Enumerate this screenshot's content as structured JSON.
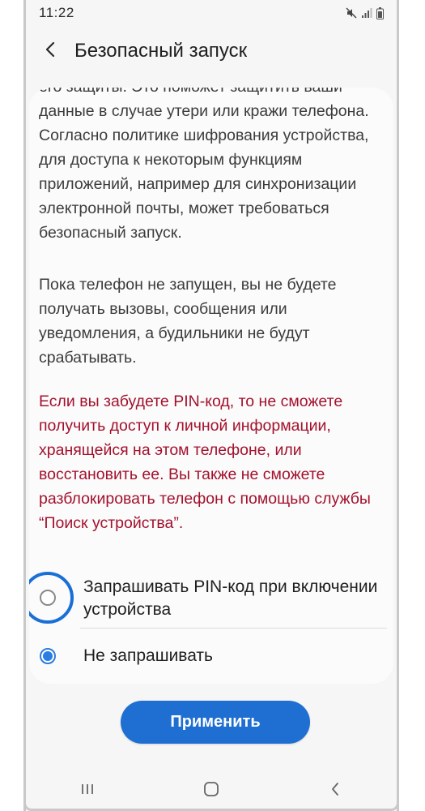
{
  "status_bar": {
    "time": "11:22",
    "icons": [
      "mute-icon",
      "signal-icon",
      "battery-icon"
    ]
  },
  "header": {
    "back_icon": "chevron-left-icon",
    "title": "Безопасный запуск"
  },
  "content": {
    "paragraph1": "его защиты. Это поможет защитить ваши данные в случае утери или кражи телефона. Согласно политике шифрования устройства, для доступа к некоторым функциям приложений, например для синхронизации электронной почты, может требоваться безопасный запуск.",
    "paragraph2": "Пока телефон не запущен, вы не будете получать вызовы, сообщения или уведомления, а будильники не будут срабатывать.",
    "warning": "Если вы забудете PIN-код, то не сможете получить доступ к личной информации, хранящейся на этом телефоне, или восстановить ее. Вы также не сможете разблокировать телефон с помощью службы “Поиск устройства”."
  },
  "options": [
    {
      "label": "Запрашивать PIN-код при включении устройства",
      "selected": false,
      "highlighted": true
    },
    {
      "label": "Не запрашивать",
      "selected": true,
      "highlighted": false
    }
  ],
  "apply_button": {
    "label": "Применить"
  },
  "nav_bar": {
    "icons": [
      "recent-apps-icon",
      "home-icon",
      "back-icon"
    ]
  },
  "colors": {
    "accent": "#1f6fd3",
    "warning_text": "#a3112d",
    "highlight_ring": "#1a6fd6",
    "background": "#f6f6f6"
  }
}
